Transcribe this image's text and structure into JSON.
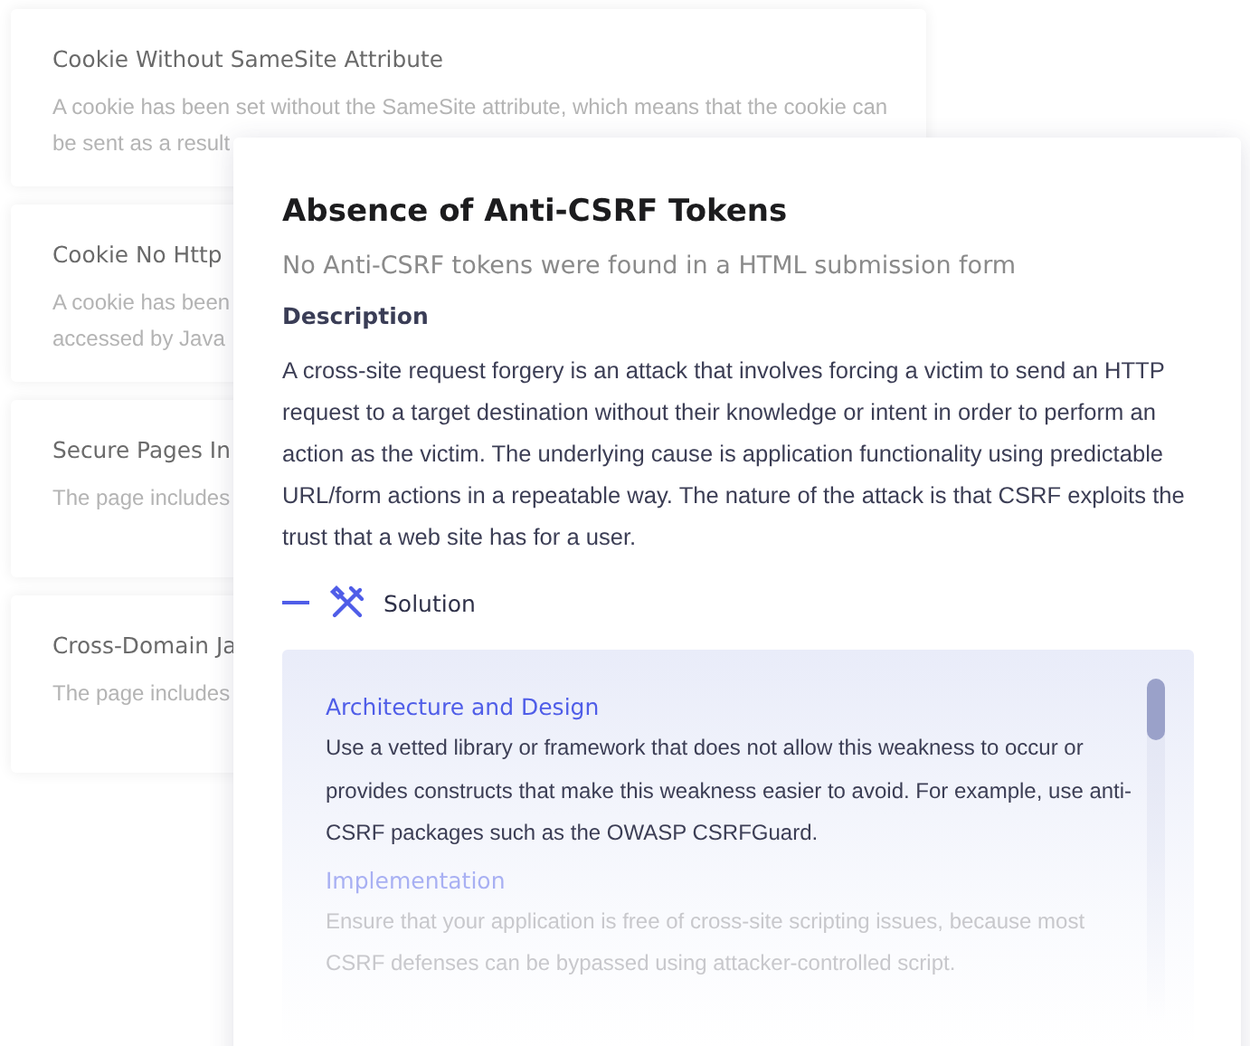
{
  "alerts": [
    {
      "title": "Cookie Without SameSite Attribute",
      "description_lines": [
        "A cookie has been set without the SameSite attribute, which means that the cookie can",
        "be sent as a result"
      ]
    },
    {
      "title": "Cookie No Http",
      "description_lines": [
        "A cookie has been",
        "accessed by Java"
      ]
    },
    {
      "title": "Secure Pages In",
      "description_lines": [
        "The page includes"
      ]
    },
    {
      "title": "Cross-Domain Ja",
      "description_lines": [
        "The page includes"
      ]
    }
  ],
  "detail": {
    "title": "Absence of Anti-CSRF Tokens",
    "subtitle": "No Anti-CSRF tokens were found in a HTML submission form",
    "description_heading": "Description",
    "description": "A cross-site request forgery is an attack that involves forcing a victim to send an HTTP request to a target destination without their knowledge or intent in order to perform an action as the victim. The underlying cause is application functionality using predictable URL/form actions in a repeatable way. The nature of the attack is that CSRF exploits the trust that a web site has for a user.",
    "solution": {
      "label": "Solution",
      "expanded": true,
      "sections": [
        {
          "heading": "Architecture and Design",
          "text": "Use a vetted library or framework that does not allow this weakness to occur or provides constructs that make this weakness easier to avoid. For example, use anti-CSRF packages such as the OWASP CSRFGuard."
        },
        {
          "heading": "Implementation",
          "text": "Ensure that your application is free of cross-site scripting issues, because most CSRF defenses can be bypassed using attacker-controlled script."
        }
      ]
    }
  }
}
